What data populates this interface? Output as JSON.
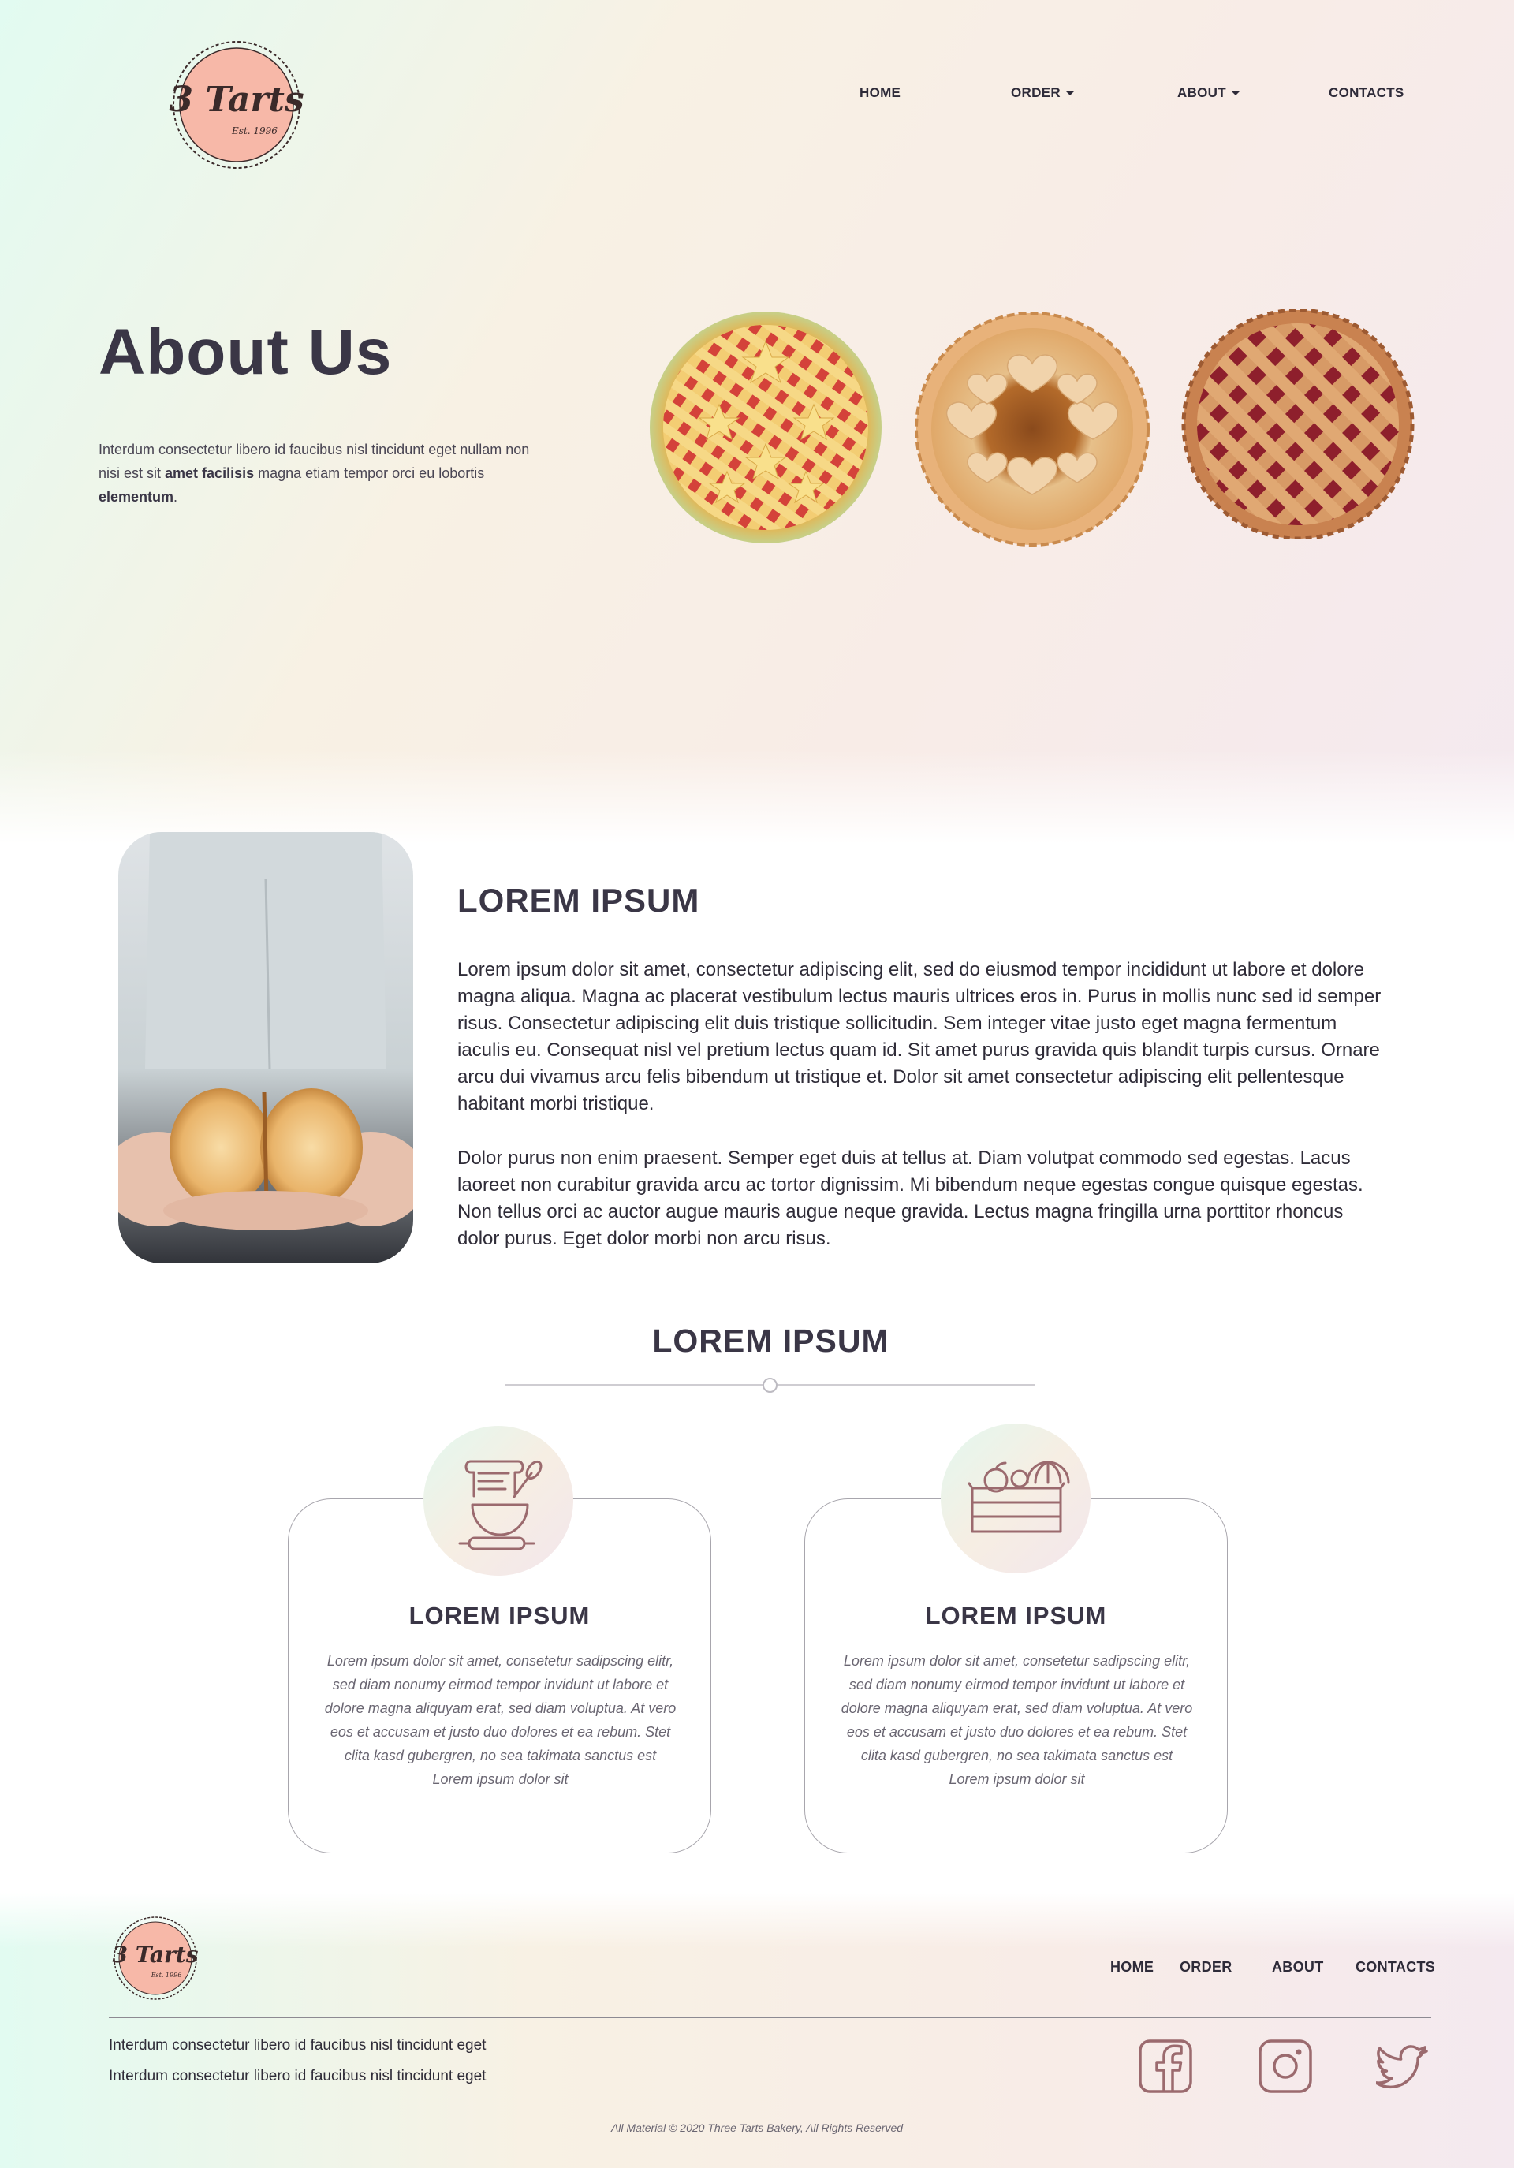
{
  "brand": {
    "logo_main": "3 Tarts",
    "logo_est": "Est. 1996"
  },
  "nav": {
    "home": "HOME",
    "order": "ORDER",
    "about": "ABOUT",
    "contacts": "CONTACTS"
  },
  "hero": {
    "title": "About Us",
    "text_1": "Interdum consectetur libero id faucibus nisl tincidunt eget nullam non nisi est sit ",
    "text_bold_1": "amet facilisis",
    "text_2": " magna etiam tempor orci eu lobortis ",
    "text_bold_2": "elementum",
    "text_3": "."
  },
  "about": {
    "title": "LOREM IPSUM",
    "paragraph_1": "Lorem ipsum dolor sit amet, consectetur adipiscing elit, sed do eiusmod tempor incididunt ut labore et dolore magna aliqua. Magna ac placerat vestibulum lectus mauris ultrices eros in. Purus in mollis nunc sed id semper risus. Consectetur adipiscing elit duis tristique sollicitudin. Sem integer vitae justo eget magna fermentum iaculis eu. Consequat nisl vel pretium lectus quam id. Sit amet purus gravida quis blandit turpis cursus. Ornare arcu dui vivamus arcu felis bibendum ut tristique et. Dolor sit amet consectetur adipiscing elit pellentesque habitant morbi tristique.",
    "paragraph_2": "Dolor purus non enim praesent. Semper eget duis at tellus at. Diam volutpat commodo sed egestas. Lacus laoreet non curabitur gravida arcu ac tortor dignissim. Mi bibendum neque egestas congue quisque egestas. Non tellus orci ac auctor augue mauris augue neque gravida. Lectus magna fringilla urna porttitor rhoncus dolor purus. Eget dolor morbi non arcu risus."
  },
  "features": {
    "title": "LOREM IPSUM",
    "cards": [
      {
        "icon": "baking-tools-icon",
        "title": "LOREM IPSUM",
        "text": "Lorem ipsum dolor sit amet, consetetur sadipscing elitr, sed diam nonumy eirmod tempor invidunt ut labore et dolore magna aliquyam erat, sed diam voluptua. At vero eos et accusam et justo duo dolores et ea rebum. Stet clita kasd gubergren, no sea takimata sanctus est Lorem ipsum dolor sit"
      },
      {
        "icon": "produce-basket-icon",
        "title": "LOREM IPSUM",
        "text": "Lorem ipsum dolor sit amet, consetetur sadipscing elitr, sed diam nonumy eirmod tempor invidunt ut labore et dolore magna aliquyam erat, sed diam voluptua. At vero eos et accusam et justo duo dolores et ea rebum. Stet clita kasd gubergren, no sea takimata sanctus est Lorem ipsum dolor sit"
      }
    ]
  },
  "footer": {
    "nav": {
      "home": "HOME",
      "order": "ORDER",
      "about": "ABOUT",
      "contacts": "CONTACTS"
    },
    "line_1": "Interdum consectetur libero id faucibus nisl tincidunt eget",
    "line_2": "Interdum consectetur libero id faucibus nisl tincidunt eget",
    "social": [
      "facebook-icon",
      "instagram-icon",
      "twitter-icon"
    ],
    "copyright_1": "All Material © 2020 ",
    "copyright_2": "Three Tarts Bakery",
    "copyright_3": ", All Rights Reserved"
  },
  "colors": {
    "heading": "#3a3646",
    "logo_fill": "#f7b8a8",
    "logo_ink": "#3b2a2a",
    "icon_stroke": "#9b6a6e"
  }
}
